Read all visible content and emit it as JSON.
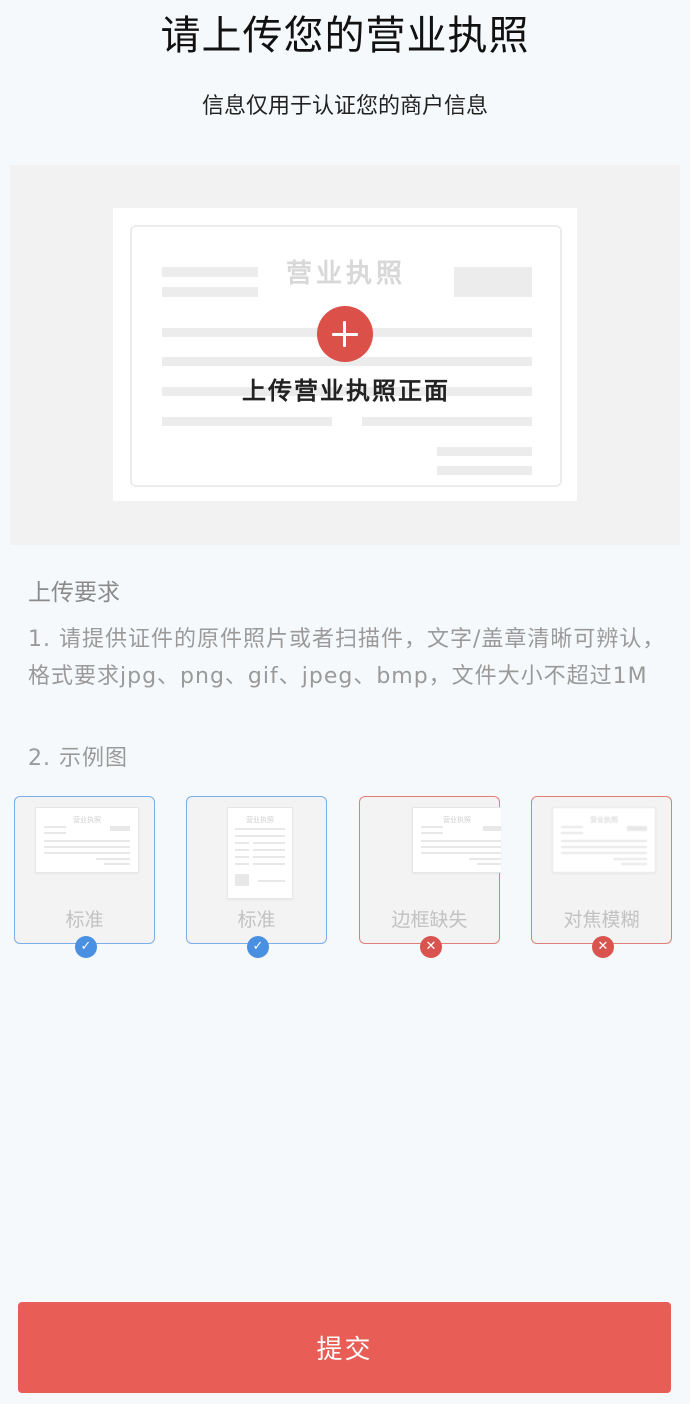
{
  "header": {
    "title": "请上传您的营业执照",
    "subtitle": "信息仅用于认证您的商户信息"
  },
  "upload": {
    "card_title": "营业执照",
    "label": "上传营业执照正面",
    "icon": "plus-icon",
    "accent_color": "#db5049"
  },
  "requirements": {
    "title": "上传要求",
    "item1": "1. 请提供证件的原件照片或者扫描件，文字/盖章清晰可辨认，格式要求jpg、png、gif、jpeg、bmp，文件大小不超过1M",
    "item2": "2. 示例图"
  },
  "examples": [
    {
      "label": "标准",
      "status": "ok",
      "badge_icon": "check-icon",
      "border_color": "#79aee8",
      "thumb_title": "营业执照"
    },
    {
      "label": "标准",
      "status": "ok",
      "badge_icon": "check-icon",
      "border_color": "#79aee8",
      "thumb_title": "营业执照"
    },
    {
      "label": "边框缺失",
      "status": "bad",
      "badge_icon": "cross-icon",
      "border_color": "#e07f79",
      "thumb_title": "营业执照"
    },
    {
      "label": "对焦模糊",
      "status": "bad",
      "badge_icon": "cross-icon",
      "border_color": "#e07f79",
      "thumb_title": "营业执照"
    }
  ],
  "footer": {
    "submit_label": "提交",
    "submit_color": "#e85d55"
  }
}
